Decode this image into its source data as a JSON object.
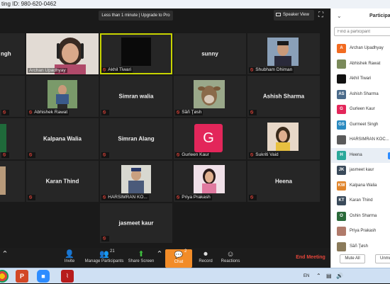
{
  "window": {
    "title_fragment": "ting ID: 980-620-0462"
  },
  "meeting": {
    "notice": "Less than 1 minute | Upgrade to Pro",
    "speaker_view": "Speaker View"
  },
  "tiles": [
    {
      "name": "ngh",
      "caption": ""
    },
    {
      "name": "",
      "caption": "Archan Upadhyay"
    },
    {
      "name": "",
      "caption": "Akhil Tiwari"
    },
    {
      "name": "sunny",
      "caption": ""
    },
    {
      "name": "",
      "caption": "Shubham Dhiman"
    },
    {
      "name": "",
      "caption": ""
    },
    {
      "name": "",
      "caption": "Abhishek Rawat"
    },
    {
      "name": "Simran walia",
      "caption": ""
    },
    {
      "name": "",
      "caption": "Sầñ Ţøsh"
    },
    {
      "name": "Ashish Sharma",
      "caption": ""
    },
    {
      "name": "",
      "caption": ""
    },
    {
      "name": "Kalpana Walia",
      "caption": ""
    },
    {
      "name": "Simran Alang",
      "caption": ""
    },
    {
      "name": "",
      "caption": "Gurleen Kaur",
      "avatar": "G"
    },
    {
      "name": "",
      "caption": "Sukriti Vaid"
    },
    {
      "name": "",
      "caption": ""
    },
    {
      "name": "Karan Thind",
      "caption": ""
    },
    {
      "name": "",
      "caption": "HARSIMRAN KO..."
    },
    {
      "name": "",
      "caption": "Priya Prakash"
    },
    {
      "name": "Heena",
      "caption": ""
    },
    {
      "name": "jasmeet kaur",
      "caption": ""
    }
  ],
  "toolbar": {
    "invite": "Invite",
    "manage": "Manage Participants",
    "participant_count": "21",
    "share": "Share Screen",
    "chat": "Chat",
    "chat_badge": "2",
    "record": "Record",
    "reactions": "Reactions",
    "end": "End Meeting"
  },
  "panel": {
    "title": "Participants",
    "search_placeholder": "Find a participant",
    "participants": [
      {
        "name": "Archan Upadhyay",
        "initials": "A",
        "color": "#f26b21"
      },
      {
        "name": "Abhishek Rawat",
        "initials": "",
        "color": "#7a8a5a"
      },
      {
        "name": "Akhil Tiwari",
        "initials": "",
        "color": "#111111"
      },
      {
        "name": "Ashish Sharma",
        "initials": "AS",
        "color": "#4a6a8a"
      },
      {
        "name": "Gurleen Kaur",
        "initials": "G",
        "color": "#e3265a"
      },
      {
        "name": "Gurmeet Singh",
        "initials": "GS",
        "color": "#2a8ac0"
      },
      {
        "name": "HARSIMRAN KOC...",
        "initials": "",
        "color": "#5a5a5a"
      },
      {
        "name": "Heena",
        "initials": "H",
        "color": "#2aa89a"
      },
      {
        "name": "jasmeet kaur",
        "initials": "JK",
        "color": "#3a4a5a"
      },
      {
        "name": "Kalpana Walia",
        "initials": "KW",
        "color": "#e0842a"
      },
      {
        "name": "Karan Thind",
        "initials": "KT",
        "color": "#3a4a5a"
      },
      {
        "name": "Oshin Sharma",
        "initials": "O",
        "color": "#2a6a3a"
      },
      {
        "name": "Priya Prakash",
        "initials": "",
        "color": "#b07a6a"
      },
      {
        "name": "Sầñ Ţøsh",
        "initials": "",
        "color": "#8a7a5a"
      }
    ],
    "mute_all": "Mute All",
    "unmute_all": "Unmu"
  },
  "taskbar": {
    "lang": "EN"
  }
}
